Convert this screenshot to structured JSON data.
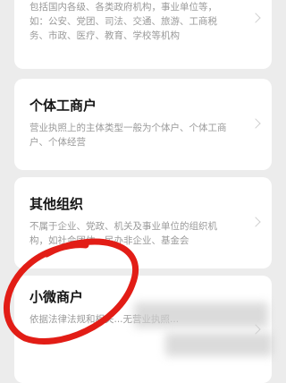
{
  "options": [
    {
      "title": "",
      "description": "包括国内各级、各类政府机构，事业单位等，如：公安、党团、司法、交通、旅游、工商税务、市政、医疗、教育、学校等机构"
    },
    {
      "title": "个体工商户",
      "description": "营业执照上的主体类型一般为个体户、个体工商户、个体经营"
    },
    {
      "title": "其他组织",
      "description": "不属于企业、党政、机关及事业单位的组织机构，如社会团体、民办非企业、基金会"
    },
    {
      "title": "小微商户",
      "description": "依据法律法规和相关...无营业执照..."
    }
  ],
  "annotation": {
    "color": "#e21d16"
  },
  "icons": {
    "chevron": "chevron-right-icon"
  }
}
